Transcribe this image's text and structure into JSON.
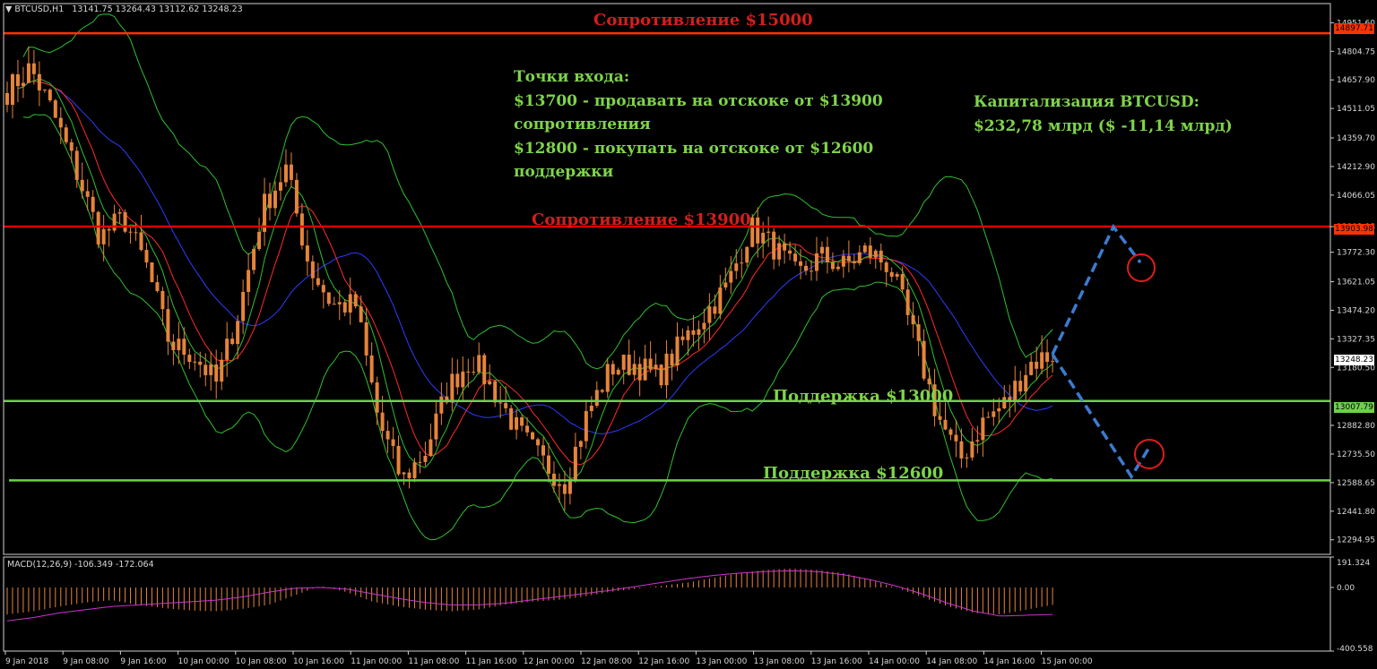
{
  "header": {
    "symbol": "BTCUSD,H1",
    "ohlc": "13141.75 13264.43 13112.62 13248.23"
  },
  "macd_header": "MACD(12,26,9) -106.349 -172.064",
  "colors": {
    "background": "#000000",
    "candle": "#e5843b",
    "resistance": "#ff3300",
    "resistance_label": "#d41e1e",
    "support": "#6ad24a",
    "annotation": "#7fd44a",
    "forecast": "#3c7bd0",
    "circle": "#e11b1b",
    "macd_signal": "#cc33cc"
  },
  "annotations": {
    "entry_title": "Точки входа:",
    "entry_line1": "$13700 - продавать на отскоке от $13900",
    "entry_line2": "сопротивления",
    "entry_line3": "$12800 - покупать на отскоке от $12600",
    "entry_line4": "поддержки",
    "cap_title": "Капитализация BTCUSD:",
    "cap_value": "$232,78 млрд ($ -11,14 млрд)"
  },
  "levels": [
    {
      "label": "Сопротивление $15000",
      "price": 14897.71,
      "badge": "14897.71",
      "kind": "resistance"
    },
    {
      "label": "Сопротивление $13900",
      "price": 13903.98,
      "badge": "13903.98",
      "kind": "resistance"
    },
    {
      "label": "Поддержка $13000",
      "price": 13007.79,
      "badge": "13007.79",
      "kind": "support"
    },
    {
      "label": "Поддержка $12600",
      "price": 12600,
      "badge": "",
      "kind": "support"
    }
  ],
  "current_price": "13248.23",
  "chart_data": [
    {
      "type": "candlestick",
      "title": "BTCUSD,H1",
      "ylim": [
        12220,
        15050
      ],
      "y_ticks": [
        "14951.60",
        "14804.75",
        "14657.90",
        "14511.05",
        "14359.70",
        "14212.90",
        "14066.05",
        "13903.98",
        "13772.30",
        "13621.05",
        "13474.20",
        "13327.35",
        "13180.50",
        "12882.80",
        "12735.50",
        "12588.65",
        "12441.80",
        "12294.95"
      ],
      "x_ticks": [
        "9 Jan 2018",
        "9 Jan 08:00",
        "9 Jan 16:00",
        "10 Jan 00:00",
        "10 Jan 08:00",
        "10 Jan 16:00",
        "11 Jan 00:00",
        "11 Jan 08:00",
        "11 Jan 16:00",
        "12 Jan 00:00",
        "12 Jan 08:00",
        "12 Jan 16:00",
        "13 Jan 00:00",
        "13 Jan 08:00",
        "13 Jan 16:00",
        "14 Jan 00:00",
        "14 Jan 08:00",
        "14 Jan 16:00",
        "15 Jan 00:00"
      ],
      "close_path": [
        14600,
        14720,
        14480,
        14180,
        13850,
        13950,
        13700,
        13300,
        13250,
        13100,
        13480,
        14000,
        14200,
        13700,
        13500,
        13500,
        12900,
        12600,
        12750,
        13080,
        13230,
        13050,
        12850,
        12700,
        12590,
        12950,
        13180,
        13200,
        13130,
        13300,
        13450,
        13600,
        13900,
        13800,
        13650,
        13750,
        13700,
        13780,
        13700,
        13350,
        12950,
        12700,
        12900,
        13000,
        13200,
        13250
      ],
      "series": [
        {
          "name": "MA fast",
          "color": "#ff2a2a"
        },
        {
          "name": "MA slow",
          "color": "#2d3cff"
        },
        {
          "name": "Bollinger",
          "color": "#2fbf2f"
        }
      ]
    },
    {
      "type": "bar",
      "title": "MACD(12,26,9) -106.349 -172.064",
      "ylim": [
        -400.558,
        191.324
      ],
      "y_ticks": [
        "191.324",
        "0.00",
        "-400.558"
      ],
      "macd_path": [
        -170,
        -150,
        -120,
        -95,
        -80,
        -110,
        -130,
        -145,
        -150,
        -135,
        -110,
        -50,
        10,
        -30,
        -90,
        -120,
        -140,
        -150,
        -140,
        -110,
        -90,
        -80,
        -60,
        -30,
        -10,
        10,
        30,
        60,
        90,
        110,
        120,
        110,
        90,
        50,
        0,
        -60,
        -120,
        -160,
        -170,
        -140,
        -110
      ],
      "signal_path": [
        -210,
        -190,
        -160,
        -140,
        -120,
        -110,
        -100,
        -90,
        -80,
        -60,
        -30,
        -5,
        0,
        -10,
        -40,
        -70,
        -95,
        -110,
        -110,
        -100,
        -80,
        -60,
        -40,
        -20,
        5,
        30,
        55,
        75,
        90,
        100,
        105,
        100,
        80,
        50,
        10,
        -40,
        -100,
        -150,
        -180,
        -175,
        -170
      ]
    }
  ]
}
